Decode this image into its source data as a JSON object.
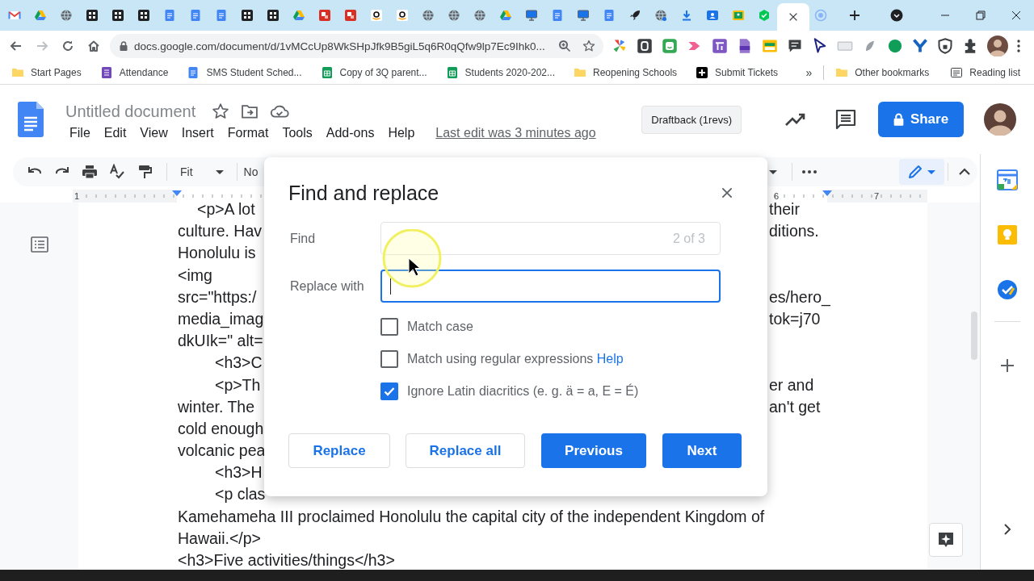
{
  "browser": {
    "tabs": [
      {
        "kind": "gmail",
        "selected": false
      },
      {
        "kind": "drive",
        "selected": false
      },
      {
        "kind": "globe",
        "selected": false
      },
      {
        "kind": "grid",
        "selected": false
      },
      {
        "kind": "grid",
        "selected": false
      },
      {
        "kind": "grid",
        "selected": false
      },
      {
        "kind": "docs",
        "selected": false
      },
      {
        "kind": "docs",
        "selected": false
      },
      {
        "kind": "docs",
        "selected": false
      },
      {
        "kind": "grid",
        "selected": false
      },
      {
        "kind": "grid",
        "selected": false
      },
      {
        "kind": "drive",
        "selected": false
      },
      {
        "kind": "red",
        "selected": false
      },
      {
        "kind": "red",
        "selected": false
      },
      {
        "kind": "amazon",
        "selected": false
      },
      {
        "kind": "amazon",
        "selected": false
      },
      {
        "kind": "globe",
        "selected": false
      },
      {
        "kind": "globe",
        "selected": false
      },
      {
        "kind": "globe",
        "selected": false
      },
      {
        "kind": "drive",
        "selected": false
      },
      {
        "kind": "monitor",
        "selected": false
      },
      {
        "kind": "docs",
        "selected": false
      },
      {
        "kind": "monitor",
        "selected": false
      },
      {
        "kind": "docs",
        "selected": false
      },
      {
        "kind": "rocket",
        "selected": false
      },
      {
        "kind": "globedot",
        "selected": false
      },
      {
        "kind": "download",
        "selected": false
      },
      {
        "kind": "contacts",
        "selected": false
      },
      {
        "kind": "yellow",
        "selected": false
      },
      {
        "kind": "greenhex",
        "selected": false
      },
      {
        "selected": true
      },
      {
        "kind": "target",
        "selected": false
      }
    ],
    "address": {
      "url": "docs.google.com/document/d/1vMCcUp8WkSHpJfk9B5giL5q6R0qQfw9lp7Ec9Ihk0..."
    },
    "bookmarks": [
      {
        "label": "Start Pages",
        "kind": "folder"
      },
      {
        "label": "Attendance",
        "kind": "form"
      },
      {
        "label": "SMS Student Sched...",
        "kind": "doc"
      },
      {
        "label": "Copy of 3Q parent...",
        "kind": "sheet"
      },
      {
        "label": "Students 2020-202...",
        "kind": "sheet"
      },
      {
        "label": "Reopening Schools",
        "kind": "folder"
      },
      {
        "label": "Submit Tickets",
        "kind": "plus"
      }
    ],
    "more_bookmarks": "»",
    "other_bookmarks": "Other bookmarks",
    "reading_list": "Reading list"
  },
  "docs": {
    "title": "Untitled document",
    "menu": [
      "File",
      "Edit",
      "View",
      "Insert",
      "Format",
      "Tools",
      "Add-ons",
      "Help"
    ],
    "last_edit": "Last edit was 3 minutes ago",
    "draftback": "Draftback (1revs)",
    "share": "Share"
  },
  "toolbar": {
    "zoom": "Fit",
    "style": "No",
    "edit_mode": {
      "selected": true
    }
  },
  "ruler": {
    "labels": [
      "1",
      "6",
      "7"
    ]
  },
  "page": {
    "lines": [
      {
        "kind": "indent",
        "left": "<p>A lot",
        "right": "their"
      },
      {
        "kind": "body",
        "left": "culture. Hav",
        "right": "ditions."
      },
      {
        "kind": "body",
        "left": "Honolulu is"
      },
      {
        "kind": "body",
        "left": "<img"
      },
      {
        "kind": "body",
        "left": "src=\"https:/",
        "right": "es/hero_"
      },
      {
        "kind": "body",
        "left": "media_imag",
        "right": "tok=j70"
      },
      {
        "kind": "body",
        "left": "dkUIk=\" alt="
      },
      {
        "kind": "tab",
        "left": "<h3>C"
      },
      {
        "kind": "tab",
        "left": "<p>Th",
        "right": "er and"
      },
      {
        "kind": "body",
        "left": "winter. The",
        "right": "an't get"
      },
      {
        "kind": "body",
        "left": "cold enough"
      },
      {
        "kind": "body",
        "left": "volcanic pea"
      },
      {
        "kind": "tab",
        "left": "<h3>H"
      },
      {
        "kind": "tab",
        "left": "<p clas"
      },
      {
        "kind": "body",
        "left": "Kamehameha III proclaimed Honolulu the capital city of the independent Kingdom of"
      },
      {
        "kind": "body",
        "left": "Hawaii.</p>"
      },
      {
        "kind": "body",
        "left": "<h3>Five activities/things</h3>"
      }
    ]
  },
  "dialog": {
    "title": "Find and replace",
    "find": {
      "label": "Find",
      "count": "2 of 3"
    },
    "replace": {
      "label": "Replace with",
      "focused": true
    },
    "options": [
      {
        "label": "Match case",
        "checked": false
      },
      {
        "label": "Match using regular expressions",
        "link": "Help",
        "checked": false
      },
      {
        "label": "Ignore Latin diacritics (e. g. ä = a, E = É)",
        "checked": true
      }
    ],
    "buttons": [
      {
        "label": "Replace",
        "kind": "outline"
      },
      {
        "label": "Replace all",
        "kind": "outline"
      },
      {
        "label": "Previous",
        "kind": "primary"
      },
      {
        "label": "Next",
        "kind": "primary"
      }
    ]
  }
}
